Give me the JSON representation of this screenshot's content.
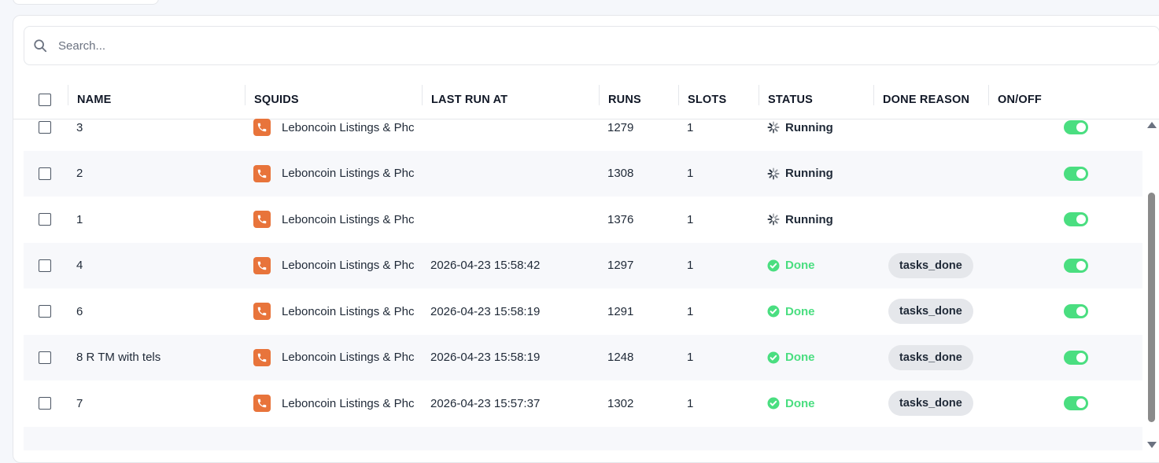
{
  "search": {
    "placeholder": "Search..."
  },
  "columns": {
    "name": "NAME",
    "squids": "SQUIDS",
    "last_run_at": "LAST RUN AT",
    "runs": "RUNS",
    "slots": "SLOTS",
    "status": "STATUS",
    "done_reason": "DONE REASON",
    "on_off": "ON/OFF"
  },
  "rows": [
    {
      "name": "3",
      "squid": "Leboncoin Listings & Phc",
      "last_run_at": "",
      "runs": "1279",
      "slots": "1",
      "status": "Running",
      "status_type": "running",
      "done_reason": "",
      "enabled": true
    },
    {
      "name": "2",
      "squid": "Leboncoin Listings & Phc",
      "last_run_at": "",
      "runs": "1308",
      "slots": "1",
      "status": "Running",
      "status_type": "running",
      "done_reason": "",
      "enabled": true
    },
    {
      "name": "1",
      "squid": "Leboncoin Listings & Phc",
      "last_run_at": "",
      "runs": "1376",
      "slots": "1",
      "status": "Running",
      "status_type": "running",
      "done_reason": "",
      "enabled": true
    },
    {
      "name": "4",
      "squid": "Leboncoin Listings & Phc",
      "last_run_at": "2026-04-23 15:58:42",
      "runs": "1297",
      "slots": "1",
      "status": "Done",
      "status_type": "done",
      "done_reason": "tasks_done",
      "enabled": true
    },
    {
      "name": "6",
      "squid": "Leboncoin Listings & Phc",
      "last_run_at": "2026-04-23 15:58:19",
      "runs": "1291",
      "slots": "1",
      "status": "Done",
      "status_type": "done",
      "done_reason": "tasks_done",
      "enabled": true
    },
    {
      "name": "8 R TM with tels",
      "squid": "Leboncoin Listings & Phc",
      "last_run_at": "2026-04-23 15:58:19",
      "runs": "1248",
      "slots": "1",
      "status": "Done",
      "status_type": "done",
      "done_reason": "tasks_done",
      "enabled": true
    },
    {
      "name": "7",
      "squid": "Leboncoin Listings & Phc",
      "last_run_at": "2026-04-23 15:57:37",
      "runs": "1302",
      "slots": "1",
      "status": "Done",
      "status_type": "done",
      "done_reason": "tasks_done",
      "enabled": true
    }
  ],
  "colors": {
    "squid_icon": "#e8743b",
    "toggle_on": "#4ade80",
    "done": "#4ade80",
    "badge_bg": "#e5e7eb"
  },
  "icons": {
    "search": "search-icon",
    "squid": "phone-icon",
    "running": "spinner-icon",
    "done": "check-circle-icon"
  }
}
